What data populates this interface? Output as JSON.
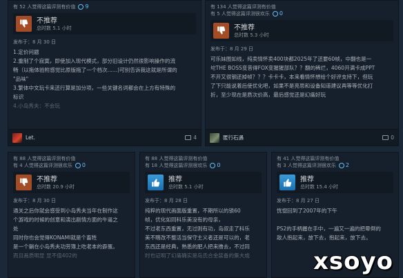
{
  "reviews": [
    {
      "helpful": "有 52 人觉得这篇评测有价值",
      "funny": "",
      "awards": "9",
      "verdict": "不推荐",
      "hours": "总时数 5.1 小时",
      "posted": "发布于：8 月 30 日",
      "lines": [
        "1.定价问题",
        "2.重制了个寂寞，即使加入现代模式，部分旧设计仍然很影响操作的流",
        "畅（以拖体验附感觉比原版拖了一个档次......)可别告诉我这就是所谓的",
        "\"品味\"",
        "3.繁体中文玩卡来还行算是加分项，一些关键名词都会在上方有特殊的",
        "标识",
        "4.小岛秀夫：不会玩"
      ],
      "user": "Let.",
      "comments": "4"
    },
    {
      "helpful": "有 134 人觉得这篇评测有价值",
      "funny": "有 5 人觉得这篇评测很欢乐",
      "awards": "0",
      "verdict": "不推荐",
      "hours": "总时数 5.3 小时",
      "posted": "发布于：8 月 29 日",
      "lines": [
        "可乐妹图如线，纯卖情怀卖400块都2025年了还要60帧，中翻也是一",
        "坨THE BOSS变昔得FOX变猩猩部队？？翻的稀烂，4060开满卡成PPT",
        "不开又很钢还掉帧？？？卡卡卡，本来看情怀想给个好评支持下，但玩",
        "了下只能说着后使优化吧，如果不是亮思和设备知道建议再等等优化打",
        "折，至少现在是质次价高，最后感觉还是幻痛好玩"
      ],
      "user": "匿行石遇",
      "comments": "0"
    },
    {
      "helpful": "有 88 人觉得这篇评测有价值",
      "funny": "有 4 人觉得这篇评测很欢乐",
      "awards": "0",
      "verdict": "不推荐",
      "hours": "总时数 20.9 小时",
      "posted": "发布于：8 月 30 日",
      "lines": [
        "通关之后你就会感受到小岛秀夫当年在制作这",
        "个游戏的时候的创意和演出剧情方面的牛逼之",
        "处",
        "同时你也会觉得KONAMI就是个畜牲",
        "是一个躺在小岛秀夫功劳簿上吃老本的孬蛋。",
        "而且画质明显 显不值402的"
      ]
    },
    {
      "helpful": "有 88 人觉得这篇评测有价值",
      "funny": "有 18 人觉得这篇评测很欢乐",
      "awards": "0",
      "verdict": "推荐",
      "hours": "总时数 5.1 小时",
      "posted": "发布于：8 月 28 日",
      "lines": [
        "纯粹的现代画面版重置，不期所以的锁60",
        "帧，优化如同科乐美没有的母亲，",
        "不过老东西重置，无过则有功，岛叔走了科乐",
        "美不瞎改不整活当保守主义者还是可以的，老",
        "东西还是经典，熟悉的肥人把来撸去，不过同",
        "时也证明了幻痛确实是岛氏合金装备的集大成"
      ]
    },
    {
      "helpful": "有 41 人觉得这篇评测有价值",
      "funny": "有 3 人觉得这篇评测很欢乐",
      "awards": "2",
      "verdict": "推荐",
      "hours": "总时数 15.4 小时",
      "posted": "发布于：8 月 27 日",
      "lines": [
        "恍惚回到了2007年的下午",
        "",
        "PS2的手柄握在手中，一遍又一遍的把晕倒的",
        "敌人抱起来，放下去，抱起来，放下去。"
      ]
    }
  ],
  "watermark": "xsoyo",
  "colors": {
    "thumb_down": "#a34c25",
    "thumb_up": "#1a7fc4",
    "accent": "#66c0f4",
    "bg": "#1b2838"
  },
  "icons": {
    "down": "thumbs-down-icon",
    "up": "thumbs-up-icon",
    "award": "award-icon",
    "comment": "comment-icon"
  }
}
